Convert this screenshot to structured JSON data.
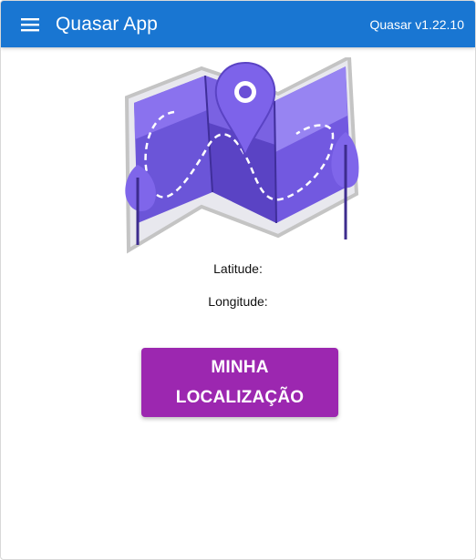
{
  "header": {
    "menu_icon": "menu-icon",
    "title": "Quasar App",
    "version": "Quasar v1.22.10"
  },
  "colors": {
    "header_bg": "#1976d2",
    "button_bg": "#9c27b0",
    "illustration_purple": "#6a4fd6"
  },
  "illustration": {
    "name": "map-location-illustration"
  },
  "location": {
    "latitude_label": "Latitude:",
    "longitude_label": "Longitude:"
  },
  "actions": {
    "locate_button": "MINHA LOCALIZAÇÃO"
  }
}
